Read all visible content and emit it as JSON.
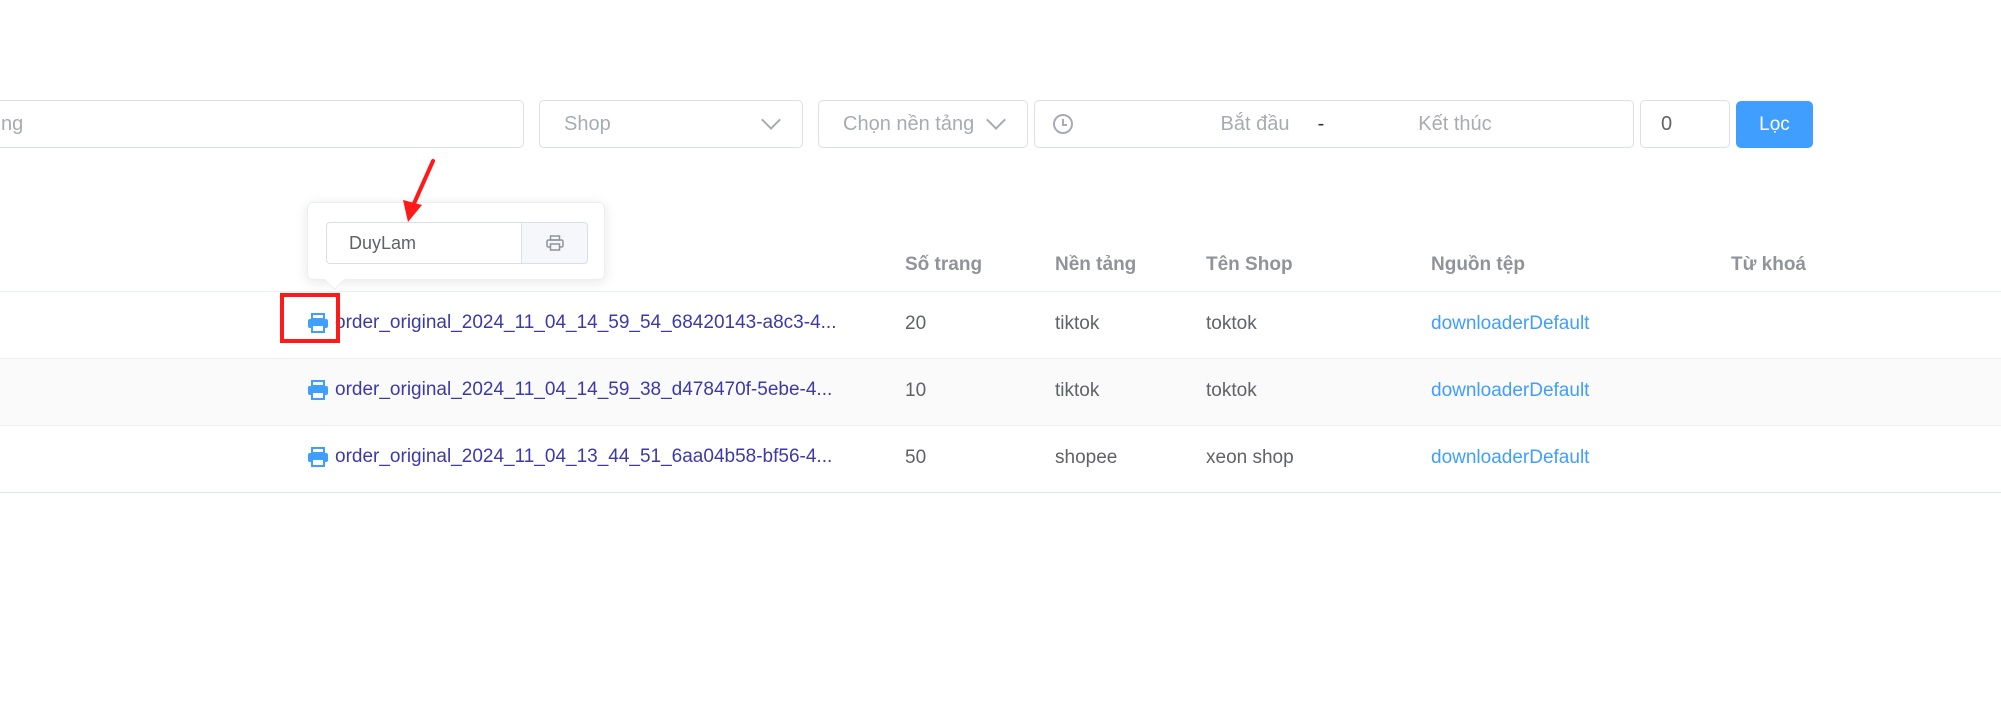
{
  "filters": {
    "search_placeholder": "ng",
    "shop_placeholder": "Shop",
    "platform_placeholder": "Chọn nền tảng",
    "date_start_placeholder": "Bắt đầu",
    "date_separator": "-",
    "date_end_placeholder": "Kết thúc",
    "number_value": "0",
    "filter_button": "Lọc"
  },
  "popover": {
    "input_value": "DuyLam"
  },
  "table": {
    "headers": {
      "pages": "Số trang",
      "platform": "Nền tảng",
      "shop_name": "Tên Shop",
      "source": "Nguồn tệp",
      "keyword": "Từ khoá"
    },
    "rows": [
      {
        "file": "order_original_2024_11_04_14_59_54_68420143-a8c3-4...",
        "pages": "20",
        "platform": "tiktok",
        "shop": "toktok",
        "source": "downloaderDefault"
      },
      {
        "file": "order_original_2024_11_04_14_59_38_d478470f-5ebe-4...",
        "pages": "10",
        "platform": "tiktok",
        "shop": "toktok",
        "source": "downloaderDefault"
      },
      {
        "file": "order_original_2024_11_04_13_44_51_6aa04b58-bf56-4...",
        "pages": "50",
        "platform": "shopee",
        "shop": "xeon shop",
        "source": "downloaderDefault"
      }
    ]
  },
  "colors": {
    "primary": "#409eff",
    "annotation": "#ff1a1a",
    "file_link": "#3d3aa8"
  },
  "icons": {
    "print": "printer-icon",
    "clock": "clock-icon",
    "chevron": "chevron-down-icon"
  }
}
